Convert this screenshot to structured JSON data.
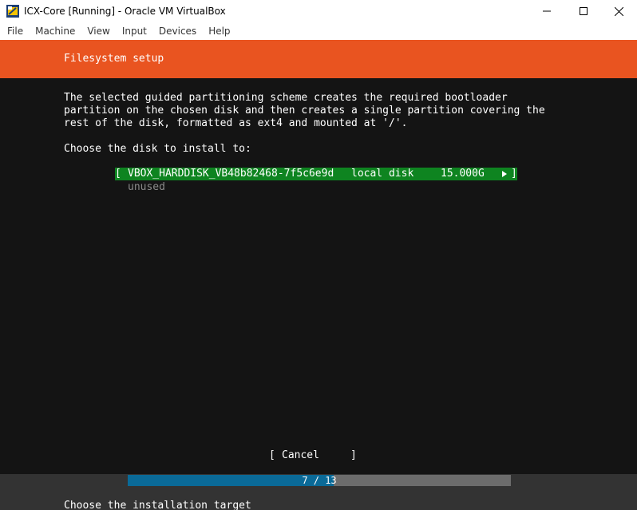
{
  "window": {
    "title": "ICX-Core [Running] - Oracle VM VirtualBox",
    "icon": "virtualbox-icon",
    "controls": [
      "minimize-icon",
      "maximize-icon",
      "close-icon"
    ]
  },
  "menu": {
    "items": [
      {
        "label": "File"
      },
      {
        "label": "Machine"
      },
      {
        "label": "View"
      },
      {
        "label": "Input"
      },
      {
        "label": "Devices"
      },
      {
        "label": "Help"
      }
    ]
  },
  "installer": {
    "header_title": "Filesystem setup",
    "header_color": "#e95420",
    "description_lines": [
      "The selected guided partitioning scheme creates the required bootloader",
      "partition on the chosen disk and then creates a single partition covering the",
      "rest of the disk, formatted as ext4 and mounted at '/'."
    ],
    "choose_label": "Choose the disk to install to:",
    "disk": {
      "bracket_open": "[",
      "name": "VBOX_HARDDISK_VB48b82468-7f5c6e9d",
      "type": "local disk",
      "size": "15.000G",
      "arrow": "▸",
      "bracket_close": "]",
      "status": "unused",
      "highlight_color": "#0e8420"
    },
    "cancel": {
      "bracket_open": "[",
      "label": "Cancel",
      "bracket_close": "]"
    },
    "progress": {
      "label": "7 / 13",
      "current": 7,
      "total": 13,
      "fill_color": "#0a6a98"
    },
    "status": "Choose the installation target"
  }
}
